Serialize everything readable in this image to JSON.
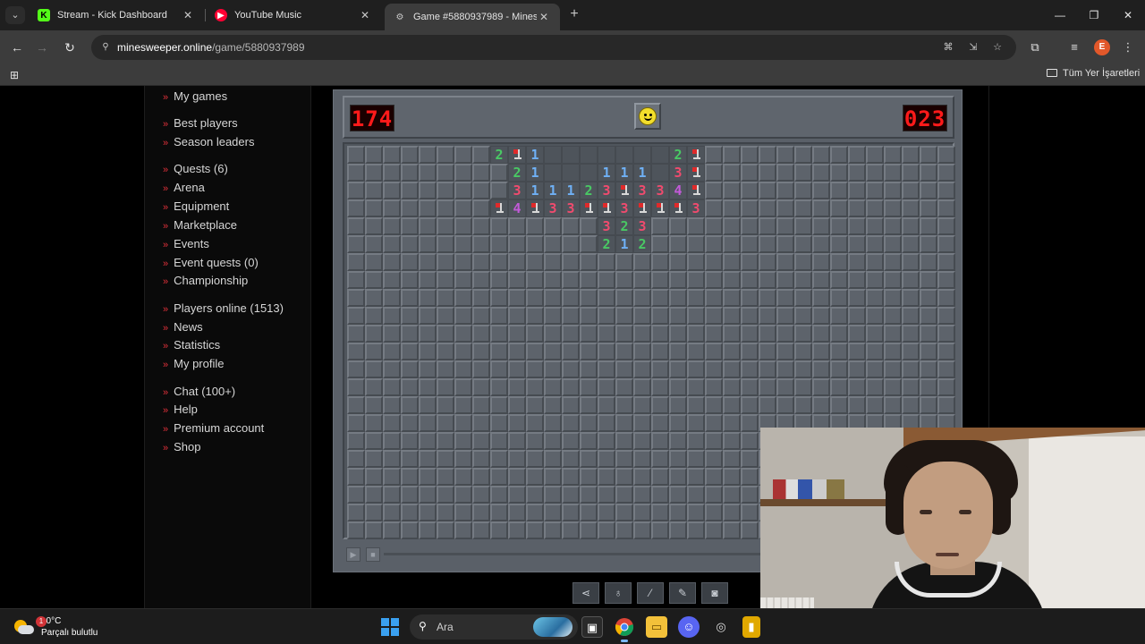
{
  "browser": {
    "tabs": [
      {
        "title": "Stream - Kick Dashboard",
        "favicon": "kick-icon",
        "active": false
      },
      {
        "title": "YouTube Music",
        "favicon": "youtube-music-icon",
        "active": false
      },
      {
        "title": "Game #5880937989 - Minesweeper",
        "favicon": "globe-icon",
        "active": true
      }
    ],
    "url_host": "minesweeper.online",
    "url_path": "/game/5880937989",
    "bookmarks_all_label": "Tüm Yer İşaretleri",
    "profile_initial": "E"
  },
  "sidebar": {
    "items": [
      {
        "label": "My games"
      },
      {
        "label": "Best players"
      },
      {
        "label": "Season leaders"
      },
      {
        "label": "Quests (6)"
      },
      {
        "label": "Arena"
      },
      {
        "label": "Equipment"
      },
      {
        "label": "Marketplace"
      },
      {
        "label": "Events"
      },
      {
        "label": "Event quests (0)"
      },
      {
        "label": "Championship"
      },
      {
        "label": "Players online (1513)"
      },
      {
        "label": "News"
      },
      {
        "label": "Statistics"
      },
      {
        "label": "My profile"
      },
      {
        "label": "Chat (100+)"
      },
      {
        "label": "Help"
      },
      {
        "label": "Premium account"
      },
      {
        "label": "Shop"
      }
    ]
  },
  "game": {
    "mines_left": "174",
    "timer": "023",
    "face": "smiley",
    "columns": 34,
    "rows": 22,
    "revealed_rows": [
      {
        "row": 0,
        "cells": [
          [
            8,
            "2"
          ],
          [
            9,
            "F"
          ],
          [
            10,
            "1"
          ],
          [
            11,
            ""
          ],
          [
            12,
            ""
          ],
          [
            13,
            ""
          ],
          [
            14,
            ""
          ],
          [
            15,
            ""
          ],
          [
            16,
            ""
          ],
          [
            17,
            ""
          ],
          [
            18,
            "2"
          ],
          [
            19,
            "F"
          ]
        ]
      },
      {
        "row": 1,
        "cells": [
          [
            9,
            "2"
          ],
          [
            10,
            "1"
          ],
          [
            11,
            ""
          ],
          [
            12,
            ""
          ],
          [
            13,
            ""
          ],
          [
            14,
            "1"
          ],
          [
            15,
            "1"
          ],
          [
            16,
            "1"
          ],
          [
            17,
            ""
          ],
          [
            18,
            "3"
          ],
          [
            19,
            "F"
          ]
        ]
      },
      {
        "row": 2,
        "cells": [
          [
            9,
            "3"
          ],
          [
            10,
            "1"
          ],
          [
            11,
            "1"
          ],
          [
            12,
            "1"
          ],
          [
            13,
            "2"
          ],
          [
            14,
            "3"
          ],
          [
            15,
            "F"
          ],
          [
            16,
            "3"
          ],
          [
            17,
            "3"
          ],
          [
            18,
            "4"
          ],
          [
            19,
            "F"
          ]
        ]
      },
      {
        "row": 3,
        "cells": [
          [
            8,
            "F"
          ],
          [
            9,
            "4"
          ],
          [
            10,
            "F"
          ],
          [
            11,
            "3"
          ],
          [
            12,
            "3"
          ],
          [
            13,
            "F"
          ],
          [
            14,
            "F"
          ],
          [
            15,
            "3"
          ],
          [
            16,
            "F"
          ],
          [
            17,
            "F"
          ],
          [
            18,
            "F"
          ],
          [
            19,
            "3"
          ]
        ]
      },
      {
        "row": 4,
        "cells": [
          [
            14,
            "3"
          ],
          [
            15,
            "2"
          ],
          [
            16,
            "3"
          ]
        ]
      },
      {
        "row": 5,
        "cells": [
          [
            14,
            "2"
          ],
          [
            15,
            "1"
          ],
          [
            16,
            "2"
          ]
        ]
      }
    ]
  },
  "tools": [
    "share-icon",
    "hint-icon",
    "magic-wand-icon",
    "edit-icon",
    "screenshot-icon"
  ],
  "taskbar": {
    "weather_temp": "10°C",
    "weather_desc": "Parçalı bulutlu",
    "weather_badge": "1",
    "search_label": "Ara"
  },
  "colors": {
    "n1": "#6fb0f5",
    "n2": "#49c864",
    "n3": "#ef4b6e",
    "n4": "#c35ad9",
    "counter_red": "#ff1a1a",
    "sidebar_bullet": "#e0303a"
  }
}
